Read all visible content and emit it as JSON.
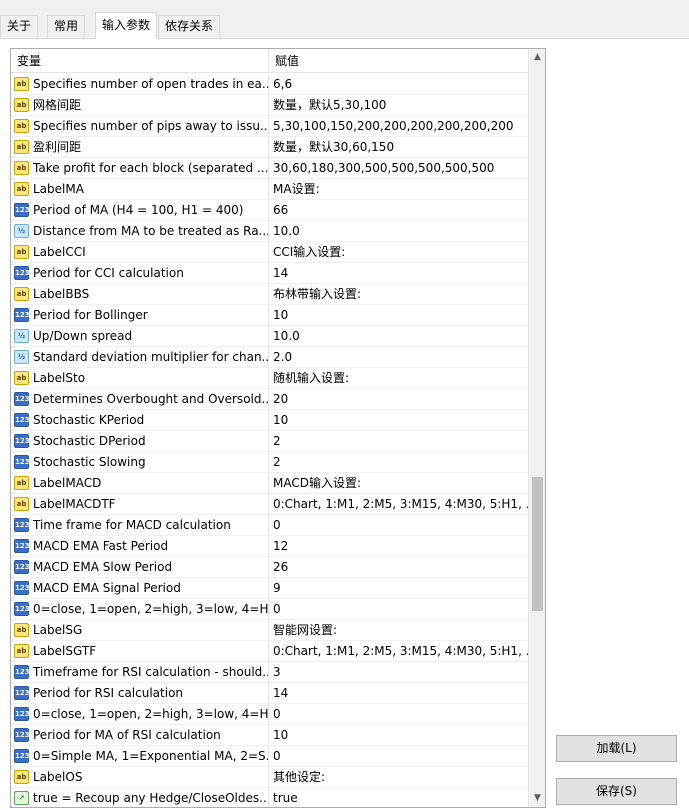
{
  "tabs": [
    {
      "label": "关于"
    },
    {
      "label": "常用"
    },
    {
      "label": "输入参数"
    },
    {
      "label": "依存关系"
    }
  ],
  "grid": {
    "headers": {
      "name": "变量",
      "value": "赋值"
    },
    "rows": [
      {
        "icon": "ab",
        "name": "Specifies number of open trades in ea...",
        "value": "6,6"
      },
      {
        "icon": "ab",
        "name": "网格间距",
        "value": "数量，默认5,30,100"
      },
      {
        "icon": "ab",
        "name": "Specifies number of pips away to issu...",
        "value": "5,30,100,150,200,200,200,200,200,200"
      },
      {
        "icon": "ab",
        "name": "盈利间距",
        "value": "数量，默认30,60,150"
      },
      {
        "icon": "ab",
        "name": "Take profit for each block (separated ...",
        "value": "30,60,180,300,500,500,500,500,500"
      },
      {
        "icon": "ab",
        "name": "LabelMA",
        "value": "MA设置:"
      },
      {
        "icon": "123",
        "name": "Period of MA (H4 = 100, H1 = 400)",
        "value": "66"
      },
      {
        "icon": "half",
        "name": "Distance from MA to be treated as Ra...",
        "value": "10.0"
      },
      {
        "icon": "ab",
        "name": "LabelCCI",
        "value": "CCI输入设置:"
      },
      {
        "icon": "123",
        "name": "Period for CCI calculation",
        "value": "14"
      },
      {
        "icon": "ab",
        "name": "LabelBBS",
        "value": "布林带输入设置:"
      },
      {
        "icon": "123",
        "name": "Period for Bollinger",
        "value": "10"
      },
      {
        "icon": "half",
        "name": "Up/Down spread",
        "value": "10.0"
      },
      {
        "icon": "half",
        "name": "Standard deviation multiplier for chan...",
        "value": "2.0"
      },
      {
        "icon": "ab",
        "name": "LabelSto",
        "value": "随机输入设置:"
      },
      {
        "icon": "123",
        "name": "Determines Overbought and Oversold...",
        "value": "20"
      },
      {
        "icon": "123",
        "name": "Stochastic KPeriod",
        "value": "10"
      },
      {
        "icon": "123",
        "name": "Stochastic DPeriod",
        "value": "2"
      },
      {
        "icon": "123",
        "name": "Stochastic Slowing",
        "value": "2"
      },
      {
        "icon": "ab",
        "name": "LabelMACD",
        "value": "MACD输入设置:"
      },
      {
        "icon": "ab",
        "name": "LabelMACDTF",
        "value": "0:Chart, 1:M1, 2:M5, 3:M15, 4:M30, 5:H1, ..."
      },
      {
        "icon": "123",
        "name": "Time frame for MACD calculation",
        "value": "0"
      },
      {
        "icon": "123",
        "name": "MACD EMA Fast Period",
        "value": "12"
      },
      {
        "icon": "123",
        "name": "MACD EMA Slow Period",
        "value": "26"
      },
      {
        "icon": "123",
        "name": "MACD EMA Signal Period",
        "value": "9"
      },
      {
        "icon": "123",
        "name": "0=close, 1=open, 2=high, 3=low, 4=H...",
        "value": "0"
      },
      {
        "icon": "ab",
        "name": "LabelSG",
        "value": "智能网设置:"
      },
      {
        "icon": "ab",
        "name": "LabelSGTF",
        "value": "0:Chart, 1:M1, 2:M5, 3:M15, 4:M30, 5:H1, ..."
      },
      {
        "icon": "123",
        "name": "Timeframe for RSI calculation - should...",
        "value": "3"
      },
      {
        "icon": "123",
        "name": "Period for RSI calculation",
        "value": "14"
      },
      {
        "icon": "123",
        "name": "0=close, 1=open, 2=high, 3=low, 4=H...",
        "value": "0"
      },
      {
        "icon": "123",
        "name": "Period for MA of RSI calculation",
        "value": "10"
      },
      {
        "icon": "123",
        "name": "0=Simple MA, 1=Exponential MA, 2=S...",
        "value": "0"
      },
      {
        "icon": "ab",
        "name": "LabelOS",
        "value": "其他设定:"
      },
      {
        "icon": "chart",
        "name": "true = Recoup any Hedge/CloseOldes...",
        "value": "true"
      }
    ]
  },
  "icon_glyphs": {
    "ab": "ab",
    "123": "123",
    "half": "½",
    "chart": "↗"
  },
  "buttons": {
    "load": "加载(L)",
    "save": "保存(S)"
  }
}
